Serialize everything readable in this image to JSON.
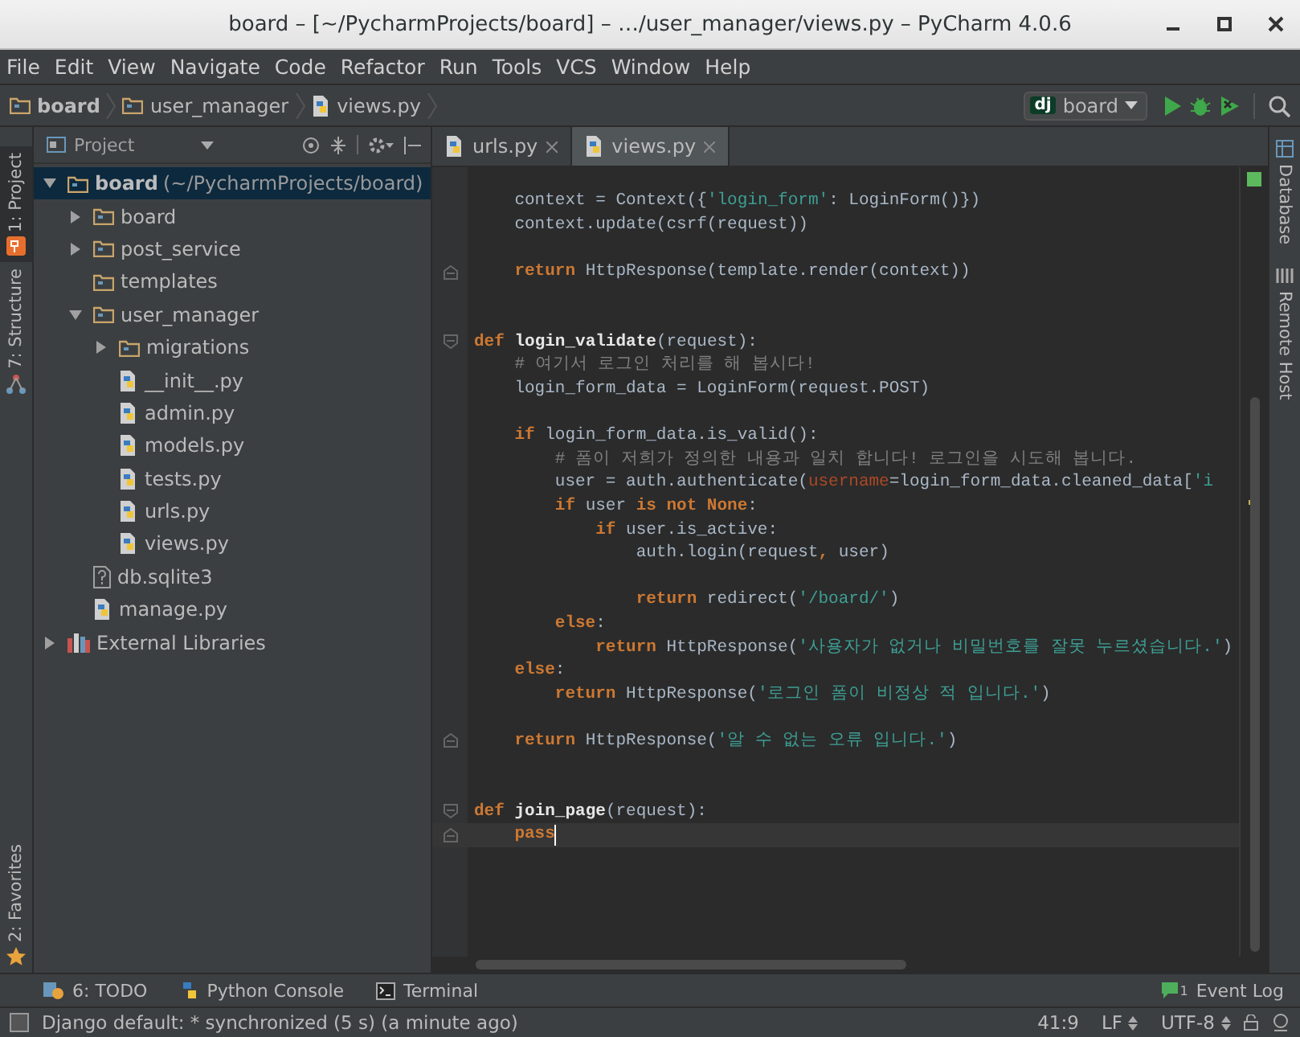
{
  "window": {
    "title": "board – [~/PycharmProjects/board] – …/user_manager/views.py – PyCharm 4.0.6"
  },
  "menu": [
    "File",
    "Edit",
    "View",
    "Navigate",
    "Code",
    "Refactor",
    "Run",
    "Tools",
    "VCS",
    "Window",
    "Help"
  ],
  "breadcrumbs": [
    {
      "label": "board",
      "kind": "folder"
    },
    {
      "label": "user_manager",
      "kind": "folder"
    },
    {
      "label": "views.py",
      "kind": "python"
    }
  ],
  "run_config": {
    "badge": "dj",
    "label": "board"
  },
  "left_stripe": [
    {
      "label": "1: Project",
      "kind": "project",
      "selected": true
    },
    {
      "label": "7: Structure",
      "kind": "structure",
      "selected": false
    }
  ],
  "favorites": {
    "label": "2: Favorites"
  },
  "right_stripe": [
    {
      "label": "Database",
      "kind": "database"
    },
    {
      "label": "Remote Host",
      "kind": "remote"
    }
  ],
  "project": {
    "header": "Project",
    "tree": [
      {
        "label": "board",
        "detail": "(~/PycharmProjects/board)",
        "kind": "folder",
        "expanded": true,
        "selected": true,
        "children": [
          {
            "label": "board",
            "kind": "folder",
            "expanded": false,
            "selected": false
          },
          {
            "label": "post_service",
            "kind": "folder",
            "expanded": false,
            "selected": false
          },
          {
            "label": "templates",
            "kind": "folder",
            "selected": false
          },
          {
            "label": "user_manager",
            "kind": "folder",
            "expanded": true,
            "selected": false,
            "children": [
              {
                "label": "migrations",
                "kind": "folder",
                "expanded": false,
                "selected": false
              },
              {
                "label": "__init__.py",
                "kind": "python",
                "selected": false
              },
              {
                "label": "admin.py",
                "kind": "python",
                "selected": false
              },
              {
                "label": "models.py",
                "kind": "python",
                "selected": false
              },
              {
                "label": "tests.py",
                "kind": "python",
                "selected": false
              },
              {
                "label": "urls.py",
                "kind": "python",
                "selected": false
              },
              {
                "label": "views.py",
                "kind": "python",
                "selected": false
              }
            ]
          },
          {
            "label": "db.sqlite3",
            "kind": "unknown",
            "selected": false
          },
          {
            "label": "manage.py",
            "kind": "python",
            "selected": false
          }
        ]
      },
      {
        "label": "External Libraries",
        "kind": "library",
        "expanded": false,
        "selected": false
      }
    ]
  },
  "tabs": [
    {
      "label": "urls.py",
      "selected": false
    },
    {
      "label": "views.py",
      "selected": true
    }
  ],
  "code": [
    {
      "kind": "code",
      "current": false,
      "tokens": [
        {
          "kind": "plain",
          "text": "    context = Context({"
        },
        {
          "kind": "string",
          "text": "'login_form'"
        },
        {
          "kind": "plain",
          "text": ": LoginForm()})"
        }
      ]
    },
    {
      "kind": "code",
      "current": false,
      "tokens": [
        {
          "kind": "plain",
          "text": "    context.update(csrf(request))"
        }
      ]
    },
    {
      "kind": "blank"
    },
    {
      "kind": "fold_end",
      "current": false,
      "tokens": [
        {
          "kind": "keyword",
          "text": "    return"
        },
        {
          "kind": "plain",
          "text": " HttpResponse(template.render(context))"
        }
      ]
    },
    {
      "kind": "blank"
    },
    {
      "kind": "blank"
    },
    {
      "kind": "fold_start",
      "current": false,
      "tokens": [
        {
          "kind": "keyword",
          "text": "def "
        },
        {
          "kind": "function",
          "text": "login_validate"
        },
        {
          "kind": "plain",
          "text": "(request):"
        }
      ]
    },
    {
      "kind": "code",
      "current": false,
      "tokens": [
        {
          "kind": "comment",
          "text": "    # 여기서 로그인 처리를 해 봅시다!"
        }
      ]
    },
    {
      "kind": "code",
      "current": false,
      "tokens": [
        {
          "kind": "plain",
          "text": "    login_form_data = LoginForm(request.POST)"
        }
      ]
    },
    {
      "kind": "blank"
    },
    {
      "kind": "code",
      "current": false,
      "tokens": [
        {
          "kind": "keyword",
          "text": "    if"
        },
        {
          "kind": "plain",
          "text": " login_form_data.is_valid():"
        }
      ]
    },
    {
      "kind": "code",
      "current": false,
      "tokens": [
        {
          "kind": "comment",
          "text": "        # 폼이 저희가 정의한 내용과 일치 합니다! 로그인을 시도해 봅니다."
        }
      ]
    },
    {
      "kind": "code",
      "current": false,
      "tokens": [
        {
          "kind": "plain",
          "text": "        user = auth.authenticate("
        },
        {
          "kind": "parameter",
          "text": "username"
        },
        {
          "kind": "plain",
          "text": "=login_form_data.cleaned_data["
        },
        {
          "kind": "string",
          "text": "'i"
        }
      ]
    },
    {
      "kind": "code",
      "current": false,
      "tokens": [
        {
          "kind": "keyword",
          "text": "        if"
        },
        {
          "kind": "plain",
          "text": " user "
        },
        {
          "kind": "keyword",
          "text": "is not None"
        },
        {
          "kind": "plain",
          "text": ":"
        }
      ]
    },
    {
      "kind": "code",
      "current": false,
      "tokens": [
        {
          "kind": "keyword",
          "text": "            if"
        },
        {
          "kind": "plain",
          "text": " user.is_active:"
        }
      ]
    },
    {
      "kind": "code",
      "current": false,
      "tokens": [
        {
          "kind": "plain",
          "text": "                auth.login(request"
        },
        {
          "kind": "keyword",
          "text": ","
        },
        {
          "kind": "plain",
          "text": " user)"
        }
      ]
    },
    {
      "kind": "blank"
    },
    {
      "kind": "code",
      "current": false,
      "tokens": [
        {
          "kind": "keyword",
          "text": "                return"
        },
        {
          "kind": "plain",
          "text": " redirect("
        },
        {
          "kind": "string",
          "text": "'/board/'"
        },
        {
          "kind": "plain",
          "text": ")"
        }
      ]
    },
    {
      "kind": "code",
      "current": false,
      "tokens": [
        {
          "kind": "keyword",
          "text": "        else"
        },
        {
          "kind": "plain",
          "text": ":"
        }
      ]
    },
    {
      "kind": "code",
      "current": false,
      "tokens": [
        {
          "kind": "keyword",
          "text": "            return"
        },
        {
          "kind": "plain",
          "text": " HttpResponse("
        },
        {
          "kind": "string",
          "text": "'사용자가 없거나 비밀번호를 잘못 누르셨습니다.'"
        },
        {
          "kind": "plain",
          "text": ")"
        }
      ]
    },
    {
      "kind": "code",
      "current": false,
      "tokens": [
        {
          "kind": "keyword",
          "text": "    else"
        },
        {
          "kind": "plain",
          "text": ":"
        }
      ]
    },
    {
      "kind": "code",
      "current": false,
      "tokens": [
        {
          "kind": "keyword",
          "text": "        return"
        },
        {
          "kind": "plain",
          "text": " HttpResponse("
        },
        {
          "kind": "string",
          "text": "'로그인 폼이 비정상 적 입니다.'"
        },
        {
          "kind": "plain",
          "text": ")"
        }
      ]
    },
    {
      "kind": "blank"
    },
    {
      "kind": "fold_end",
      "current": false,
      "tokens": [
        {
          "kind": "keyword",
          "text": "    return"
        },
        {
          "kind": "plain",
          "text": " HttpResponse("
        },
        {
          "kind": "string",
          "text": "'알 수 없는 오류 입니다.'"
        },
        {
          "kind": "plain",
          "text": ")"
        }
      ]
    },
    {
      "kind": "blank"
    },
    {
      "kind": "blank"
    },
    {
      "kind": "fold_start",
      "current": false,
      "tokens": [
        {
          "kind": "keyword",
          "text": "def "
        },
        {
          "kind": "function",
          "text": "join_page"
        },
        {
          "kind": "plain",
          "text": "(request):"
        }
      ]
    },
    {
      "kind": "fold_end",
      "current": true,
      "tokens": [
        {
          "kind": "keyword",
          "text": "    pass"
        }
      ]
    }
  ],
  "tool_buttons": [
    {
      "label": "6: TODO",
      "kind": "todo"
    },
    {
      "label": "Python Console",
      "kind": "console"
    },
    {
      "label": "Terminal",
      "kind": "terminal"
    }
  ],
  "event_log": {
    "count": "1",
    "label": "Event Log"
  },
  "status_bar": {
    "message": "Django default: * synchronized (5 s) (a minute ago)",
    "position": "41:9",
    "line_ending": "LF",
    "encoding": "UTF-8"
  }
}
